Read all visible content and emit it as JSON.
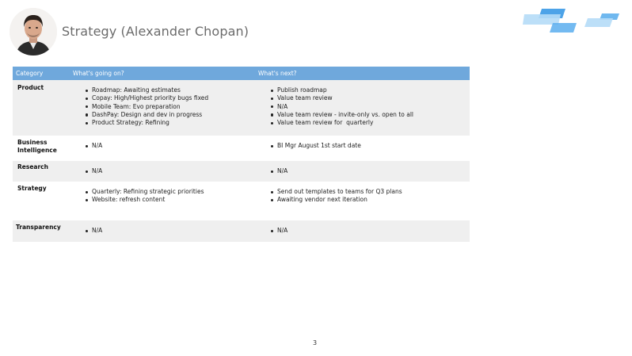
{
  "header": {
    "title": "Strategy (Alexander Chopan)"
  },
  "table": {
    "columns": [
      "Category",
      "What's going on?",
      "What's next?"
    ],
    "rows": [
      {
        "category": "Product",
        "going_on": [
          "Roadmap: Awaiting estimates",
          "Copay: High/Highest priority bugs fixed",
          "Mobile Team: Evo preparation",
          "DashPay: Design and dev in progress",
          "Product Strategy: Refining"
        ],
        "next": [
          "Publish roadmap",
          "Value team review",
          "N/A",
          "Value team review - invite-only vs. open to all",
          "Value team review for  quarterly"
        ]
      },
      {
        "category": "Business Intelligence",
        "going_on": [
          "N/A"
        ],
        "next": [
          "BI Mgr August 1st start date"
        ]
      },
      {
        "category": "Research",
        "going_on": [
          "N/A"
        ],
        "next": [
          "N/A"
        ]
      },
      {
        "category": "Strategy",
        "going_on": [
          "Quarterly: Refining strategic priorities",
          "Website: refresh content"
        ],
        "next": [
          "Send out templates to teams for Q3 plans",
          "Awaiting vendor next iteration"
        ]
      },
      {
        "category": "Transparency",
        "going_on": [
          "N/A"
        ],
        "next": [
          "N/A"
        ]
      }
    ]
  },
  "footer": {
    "page_number": "3"
  },
  "icons": {
    "avatar": "portrait-photo",
    "logo": "blue-parallelogram-logo"
  },
  "colors": {
    "header_bg": "#6fa8dc",
    "row_shade": "#efefef",
    "logo_dark": "#4da3e8",
    "logo_light": "#a9d4f5"
  }
}
